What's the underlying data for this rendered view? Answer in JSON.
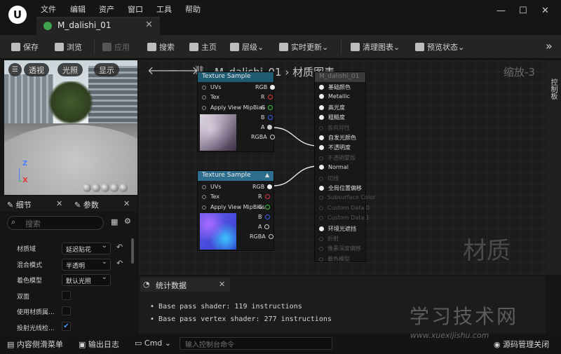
{
  "menu": [
    "文件",
    "编辑",
    "资产",
    "窗口",
    "工具",
    "帮助"
  ],
  "tab": {
    "label": "M_dalishi_01"
  },
  "toolbar": [
    {
      "label": "保存",
      "icon": "save-icon",
      "enabled": true
    },
    {
      "label": "浏览",
      "icon": "browse-icon",
      "enabled": true
    },
    {
      "label": "应用",
      "icon": "apply-icon",
      "enabled": false
    },
    {
      "label": "搜索",
      "icon": "search-icon",
      "enabled": true
    },
    {
      "label": "主页",
      "icon": "home-icon",
      "enabled": true
    },
    {
      "label": "层级⌄",
      "icon": "hierarchy-icon",
      "enabled": true
    },
    {
      "label": "实时更新⌄",
      "icon": "live-update-icon",
      "enabled": true
    },
    {
      "label": "清理图表⌄",
      "icon": "clean-graph-icon",
      "enabled": true
    },
    {
      "label": "预览状态⌄",
      "icon": "preview-state-icon",
      "enabled": true
    }
  ],
  "viewport": {
    "buttons": [
      "透视",
      "光照",
      "显示"
    ],
    "axis_z": "Z",
    "axis_x": "X"
  },
  "details": {
    "tabs": [
      "细节",
      "参数"
    ],
    "search_placeholder": "搜索",
    "rows": [
      {
        "label": "材质域",
        "value": "延迟贴花",
        "type": "dropdown"
      },
      {
        "label": "混合模式",
        "value": "半透明",
        "type": "dropdown"
      },
      {
        "label": "着色模型",
        "value": "默认光照",
        "type": "dropdown"
      },
      {
        "label": "双面",
        "type": "checkbox",
        "checked": false
      },
      {
        "label": "使用材质属...",
        "type": "checkbox",
        "checked": false
      },
      {
        "label": "投射光线检...",
        "type": "checkbox",
        "checked": true
      }
    ]
  },
  "graph": {
    "breadcrumb": "M_dalishi_01",
    "title": "材质图表",
    "zoom": "缩放-3",
    "watermark": "材质",
    "side_panel": "控制板",
    "node1": {
      "title": "Texture Sample",
      "inputs": [
        "UVs",
        "Tex",
        "Apply View MipBias"
      ],
      "outputs": [
        "RGB",
        "R",
        "G",
        "B",
        "A",
        "RGBA"
      ]
    },
    "node2": {
      "title": "Texture Sample",
      "inputs": [
        "UVs",
        "Tex",
        "Apply View MipBias"
      ],
      "outputs": [
        "RGB",
        "R",
        "G",
        "B",
        "A",
        "RGBA"
      ]
    },
    "result": {
      "title": "M_dalishi_01",
      "pins": [
        {
          "label": "基础颜色",
          "active": true
        },
        {
          "label": "Metallic",
          "active": true
        },
        {
          "label": "高光度",
          "active": true
        },
        {
          "label": "粗糙度",
          "active": true
        },
        {
          "label": "各向异性",
          "active": false
        },
        {
          "label": "自发光颜色",
          "active": true
        },
        {
          "label": "不透明度",
          "active": true
        },
        {
          "label": "不透明蒙版",
          "active": false
        },
        {
          "label": "Normal",
          "active": true
        },
        {
          "label": "切线",
          "active": false
        },
        {
          "label": "全局位置偏移",
          "active": true
        },
        {
          "label": "Subsurface Color",
          "active": false
        },
        {
          "label": "Custom Data 0",
          "active": false
        },
        {
          "label": "Custom Data 1",
          "active": false
        },
        {
          "label": "环境光遮挡",
          "active": true
        },
        {
          "label": "折射",
          "active": false
        },
        {
          "label": "像素深度偏移",
          "active": false
        },
        {
          "label": "着色模型",
          "active": false
        }
      ]
    }
  },
  "stats": {
    "title": "统计数据",
    "lines": [
      "Base pass shader: 119 instructions",
      "Base pass vertex shader: 277 instructions"
    ]
  },
  "bottom": {
    "content_drawer": "内容侧滑菜单",
    "output_log": "输出日志",
    "cmd": "Cmd",
    "cmd_placeholder": "输入控制台命令",
    "source_control": "源码管理关闭"
  },
  "watermark": {
    "site": "学习技术网",
    "url": "www.xuexijishu.com"
  },
  "colors": {
    "accent_blue": "#2d6e8e",
    "pin_red": "#e03a3a",
    "pin_green": "#3ec23e",
    "pin_blue": "#3a5cf0"
  }
}
